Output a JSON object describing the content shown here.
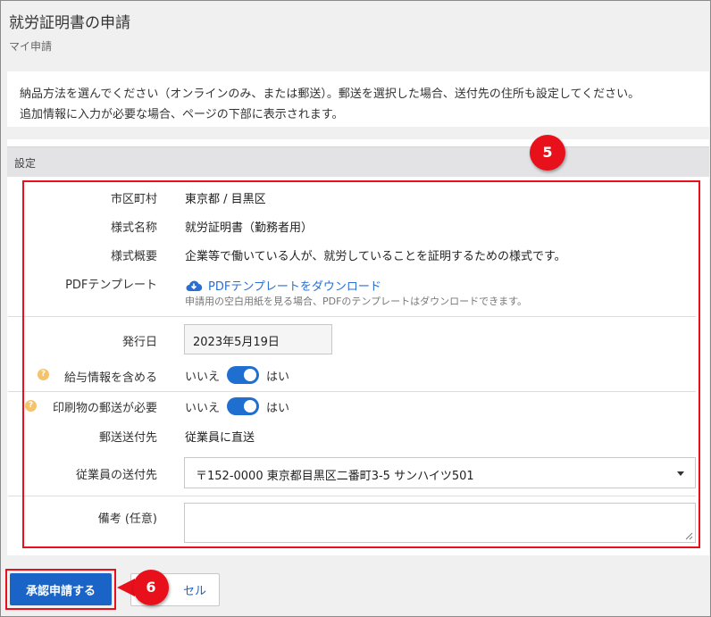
{
  "page": {
    "title": "就労証明書の申請",
    "breadcrumb": "マイ申請"
  },
  "notice": {
    "line1": "納品方法を選んでください（オンラインのみ、または郵送）。郵送を選択した場合、送付先の住所も設定してください。",
    "line2": "追加情報に入力が必要な場合、ページの下部に表示されます。"
  },
  "section": {
    "title": "設定"
  },
  "fields": {
    "municipality": {
      "label": "市区町村",
      "value": "東京都 / 目黒区"
    },
    "form_name": {
      "label": "様式名称",
      "value": "就労証明書（勤務者用）"
    },
    "form_summary": {
      "label": "様式概要",
      "value": "企業等で働いている人が、就労していることを証明するための様式です。"
    },
    "pdf_template": {
      "label": "PDFテンプレート",
      "link": "PDFテンプレートをダウンロード",
      "hint": "申請用の空白用紙を見る場合、PDFのテンプレートはダウンロードできます。"
    },
    "issue_date": {
      "label": "発行日",
      "value": "2023年5月19日"
    },
    "include_salary": {
      "label": "給与情報を含める",
      "off_label": "いいえ",
      "on_label": "はい",
      "state": "on"
    },
    "mail_required": {
      "label": "印刷物の郵送が必要",
      "off_label": "いいえ",
      "on_label": "はい",
      "state": "on"
    },
    "mail_destination": {
      "label": "郵送送付先",
      "value": "従業員に直送"
    },
    "employee_address": {
      "label": "従業員の送付先",
      "value": "〒152-0000 東京都目黒区二番町3-5 サンハイツ501"
    },
    "remarks": {
      "label": "備考 (任意)",
      "value": ""
    }
  },
  "buttons": {
    "submit": "承認申請する",
    "cancel": "セル"
  },
  "annotations": {
    "badge5": "5",
    "badge6": "6"
  },
  "colors": {
    "accent": "#1a63c7",
    "annotation": "#e8101a",
    "help": "#f5c36a"
  },
  "icons": {
    "download": "cloud-download-icon",
    "help": "help-icon",
    "caret": "caret-down-icon"
  }
}
